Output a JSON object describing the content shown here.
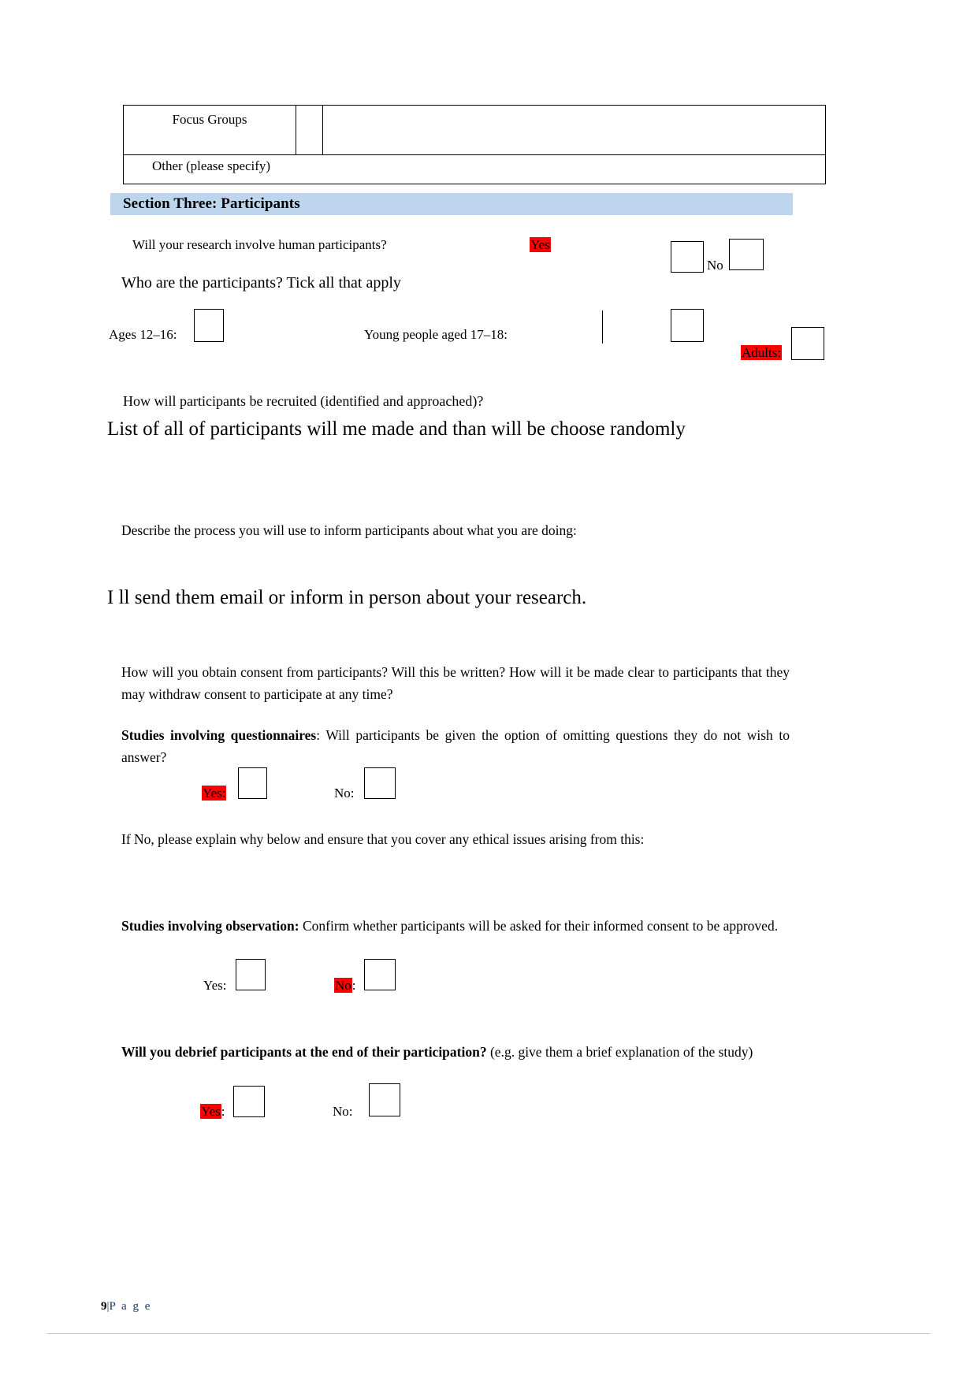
{
  "document": {
    "page_number": "9",
    "page_label": "P a g e",
    "page_separator": "|"
  },
  "top_table": {
    "rows": [
      {
        "label": "Focus Groups",
        "tick": "",
        "note": ""
      },
      {
        "label": "Other (please specify)",
        "tick": "",
        "note": ""
      }
    ]
  },
  "section": {
    "title": "Section Three: Participants"
  },
  "questions": {
    "human_participants": {
      "text": "Will your research involve human participants?",
      "yes_label": "Yes",
      "yes_highlighted": true,
      "no_label": "No",
      "no_highlighted": false
    },
    "who_are_participants": {
      "text": "Who are the participants? Tick all that apply",
      "options": [
        {
          "label": "Ages 12–16:",
          "highlighted": false
        },
        {
          "label": "Young people aged 17–18:",
          "highlighted": false
        },
        {
          "label": "Adults:",
          "highlighted": true
        }
      ]
    },
    "recruitment": {
      "prompt": "How will participants be recruited (identified and approached)?",
      "answer": "List of all of participants will me made and than will be choose randomly"
    },
    "inform_process": {
      "prompt": "Describe the process you will use to inform participants about what you are doing:",
      "answer": "I ll send them email or inform in person about your research."
    },
    "consent": {
      "prompt": "How will you obtain consent from participants? Will this be written? How will it be made clear to participants that they may withdraw consent to participate at any time?",
      "questionnaires_bold": "Studies involving questionnaires",
      "questionnaires_rest": ": Will participants be given the option of omitting questions they do not wish to answer?",
      "yes_label": "Yes:",
      "yes_highlighted": true,
      "no_label": "No:",
      "no_highlighted": false
    },
    "if_no_explain": {
      "text": "If No, please explain why below and ensure that you cover any ethical issues arising from this:"
    },
    "observation": {
      "bold": "Studies involving observation:",
      "rest": " Confirm whether participants will be asked for their informed consent to be approved.",
      "yes_label": "Yes:",
      "yes_highlighted": false,
      "no_label": "No",
      "no_suffix": ":",
      "no_highlighted": true
    },
    "debrief": {
      "bold": "Will you debrief participants at the end of their participation?",
      "rest": " (e.g. give them a brief explanation of the study)",
      "yes_label": "Yes",
      "yes_suffix": ":",
      "yes_highlighted": true,
      "no_label": "No:",
      "no_highlighted": false
    }
  },
  "colors": {
    "banner": "#bdd6ee",
    "highlight": "#ff0000",
    "footer_text": "#17365d"
  }
}
